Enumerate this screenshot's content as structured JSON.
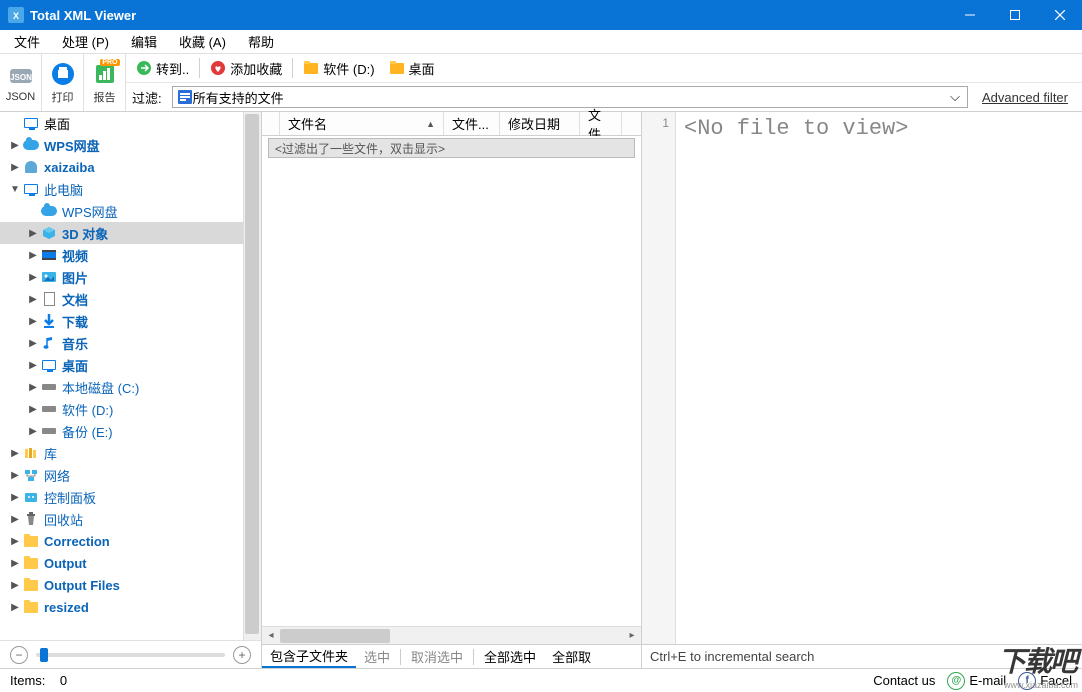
{
  "app_title": "Total XML Viewer",
  "menu": [
    "文件",
    "处理 (P)",
    "编辑",
    "收藏 (A)",
    "帮助"
  ],
  "toolbar": {
    "big": [
      {
        "label": "JSON",
        "icon": "json-icon"
      },
      {
        "label": "打印",
        "icon": "print-icon"
      },
      {
        "label": "报告",
        "icon": "report-icon",
        "pro": true
      }
    ],
    "row1": [
      {
        "label": "转到..",
        "icon": "goto-icon"
      },
      {
        "label": "添加收藏",
        "icon": "fav-icon"
      },
      {
        "label": "软件 (D:)",
        "icon": "folder-open-icon"
      },
      {
        "label": "桌面",
        "icon": "folder-open-icon"
      }
    ],
    "filter_label": "过滤:",
    "filter_value": "所有支持的文件",
    "adv_filter": "Advanced filter"
  },
  "tree": [
    {
      "depth": 0,
      "expand": "",
      "icon": "monitor",
      "label": "桌面",
      "blue": false
    },
    {
      "depth": 0,
      "expand": "▶",
      "icon": "cloud",
      "label": "WPS网盘",
      "bold": true
    },
    {
      "depth": 0,
      "expand": "▶",
      "icon": "user",
      "label": "xaizaiba",
      "bold": true
    },
    {
      "depth": 0,
      "expand": "▼",
      "icon": "monitor",
      "label": "此电脑",
      "blue": true
    },
    {
      "depth": 1,
      "expand": "",
      "icon": "cloud",
      "label": "WPS网盘",
      "blue": true
    },
    {
      "depth": 1,
      "expand": "▶",
      "icon": "box3d",
      "label": "3D 对象",
      "bold": true,
      "selected": true
    },
    {
      "depth": 1,
      "expand": "▶",
      "icon": "video",
      "label": "视频",
      "bold": true
    },
    {
      "depth": 1,
      "expand": "▶",
      "icon": "image",
      "label": "图片",
      "bold": true
    },
    {
      "depth": 1,
      "expand": "▶",
      "icon": "doc",
      "label": "文档",
      "bold": true
    },
    {
      "depth": 1,
      "expand": "▶",
      "icon": "download",
      "label": "下载",
      "bold": true
    },
    {
      "depth": 1,
      "expand": "▶",
      "icon": "music",
      "label": "音乐",
      "bold": true
    },
    {
      "depth": 1,
      "expand": "▶",
      "icon": "monitor",
      "label": "桌面",
      "bold": true
    },
    {
      "depth": 1,
      "expand": "▶",
      "icon": "drive",
      "label": "本地磁盘 (C:)",
      "blue": true
    },
    {
      "depth": 1,
      "expand": "▶",
      "icon": "drive",
      "label": "软件 (D:)",
      "blue": true
    },
    {
      "depth": 1,
      "expand": "▶",
      "icon": "drive",
      "label": "备份 (E:)",
      "blue": true
    },
    {
      "depth": 0,
      "expand": "▶",
      "icon": "lib",
      "label": "库",
      "blue": true
    },
    {
      "depth": 0,
      "expand": "▶",
      "icon": "network",
      "label": "网络",
      "blue": true
    },
    {
      "depth": 0,
      "expand": "▶",
      "icon": "control",
      "label": "控制面板",
      "blue": true
    },
    {
      "depth": 0,
      "expand": "▶",
      "icon": "recycle",
      "label": "回收站",
      "blue": true
    },
    {
      "depth": 0,
      "expand": "▶",
      "icon": "folder",
      "label": "Correction",
      "bold": true
    },
    {
      "depth": 0,
      "expand": "▶",
      "icon": "folder",
      "label": "Output",
      "bold": true
    },
    {
      "depth": 0,
      "expand": "▶",
      "icon": "folder",
      "label": "Output Files",
      "bold": true
    },
    {
      "depth": 0,
      "expand": "▶",
      "icon": "folder",
      "label": "resized",
      "bold": true
    }
  ],
  "filelist": {
    "columns": [
      {
        "label": "文件名",
        "width": 164,
        "sort": "▲"
      },
      {
        "label": "文件...",
        "width": 56
      },
      {
        "label": "修改日期",
        "width": 80
      },
      {
        "label": "文件",
        "width": 42
      }
    ],
    "filter_row": "<过滤出了一些文件，双击显示>",
    "tabs": [
      "包含子文件夹",
      "选中",
      "取消选中",
      "全部选中",
      "全部取"
    ],
    "active_tab": 0
  },
  "preview": {
    "line_no": "1",
    "text": "<No file to view>",
    "hint": "Ctrl+E to incremental search"
  },
  "status": {
    "items_label": "Items:",
    "items_count": "0",
    "contact": "Contact us",
    "email": "E-mail",
    "facebook": "Facel"
  },
  "watermark": {
    "big": "下载吧",
    "url": "www.xiazaiba.com"
  }
}
